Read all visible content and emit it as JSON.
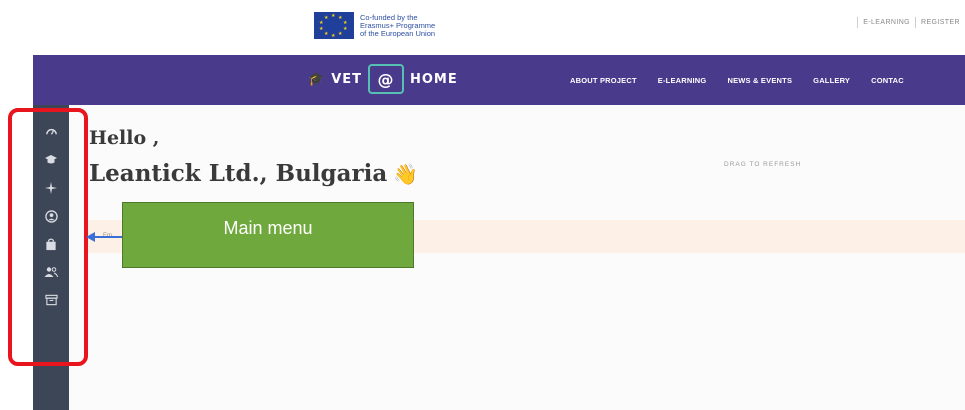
{
  "topbar": {
    "eu_text_lines": [
      "Co-funded by the",
      "Erasmus+ Programme",
      "of the European Union"
    ],
    "links": [
      "E-LEARNING",
      "REGISTER"
    ]
  },
  "navbar": {
    "logo_left": "VET",
    "logo_mid": "@",
    "logo_right": "HOME",
    "items": [
      "ABOUT PROJECT",
      "E-LEARNING",
      "NEWS & EVENTS",
      "GALLERY",
      "CONTAC"
    ]
  },
  "sidebar": {
    "icons": [
      "dashboard-icon",
      "graduation-cap-icon",
      "sparkle-icon",
      "user-circle-icon",
      "bag-icon",
      "users-icon",
      "archive-icon"
    ]
  },
  "main": {
    "hello": "Hello ,",
    "organization": "Leantick Ltd., Bulgaria",
    "wave": "👋",
    "drag_refresh": "DRAG TO REFRESH",
    "notice": "Em"
  },
  "annotation": {
    "callout_label": "Main menu",
    "frame_color": "#e8141e",
    "callout_color": "#6fa83c",
    "arrow_color": "#3c6fd6"
  },
  "colors": {
    "navbar": "#4a3a8c",
    "sidebar": "#3d4656",
    "accent_teal": "#56c1b3",
    "notice_bg": "#fdf1e7"
  }
}
